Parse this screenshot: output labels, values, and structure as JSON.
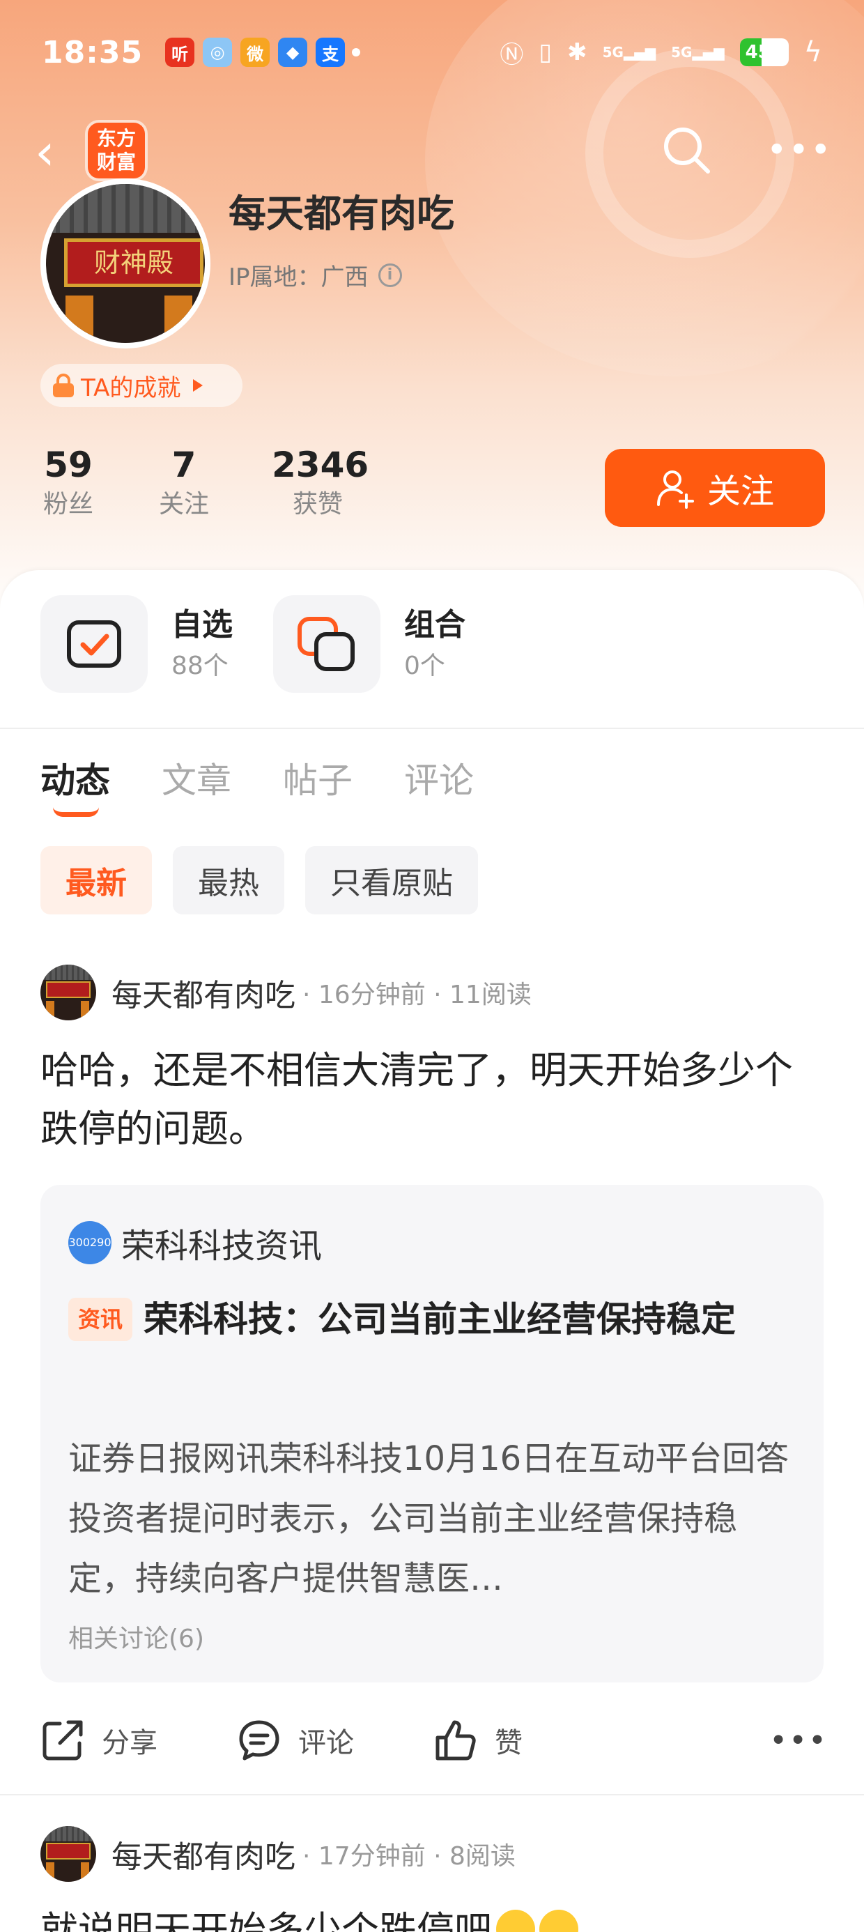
{
  "status_bar": {
    "time": "18:35",
    "app_icons": [
      {
        "name": "ting-app-icon",
        "glyph": "听",
        "color": "#e8321f"
      },
      {
        "name": "photos-app-icon",
        "glyph": "◎",
        "color": "#8dc6f5"
      },
      {
        "name": "weibo-app-icon",
        "glyph": "微",
        "color": "#f7a521"
      },
      {
        "name": "shazam-app-icon",
        "glyph": "◆",
        "color": "#2f86f2"
      },
      {
        "name": "alipay-app-icon",
        "glyph": "支",
        "color": "#1677ff"
      }
    ],
    "signal_1": "5G",
    "signal_2": "5G",
    "battery_level": "45",
    "battery_fraction": 0.45
  },
  "header": {
    "brand_badge": "东方\n财富"
  },
  "profile": {
    "name": "每天都有肉吃",
    "ip_label": "IP属地：广西",
    "achievement": "TA的成就",
    "avatar_plaque": "财神殿",
    "stats": [
      {
        "value": "59",
        "label": "粉丝"
      },
      {
        "value": "7",
        "label": "关注"
      },
      {
        "value": "2346",
        "label": "获赞"
      }
    ],
    "follow_label": "关注"
  },
  "shortcuts": [
    {
      "title": "自选",
      "count": "88个"
    },
    {
      "title": "组合",
      "count": "0个"
    }
  ],
  "tabs": [
    "动态",
    "文章",
    "帖子",
    "评论"
  ],
  "filters": [
    "最新",
    "最热",
    "只看原贴"
  ],
  "posts": [
    {
      "author": "每天都有肉吃",
      "meta": "· 16分钟前 · 11阅读",
      "text": "哈哈，还是不相信大清完了，明天开始多少个跌停的问题。",
      "quote": {
        "source_code": "300290",
        "source_name": "荣科科技资讯",
        "tag": "资讯",
        "title": "荣科科技：公司当前主业经营保持稳定",
        "body": "证券日报网讯荣科科技10月16日在互动平台回答投资者提问时表示，公司当前主业经营保持稳定，持续向客户提供智慧医…",
        "related": "相关讨论(6)"
      },
      "actions": {
        "share": "分享",
        "comment": "评论",
        "like": "赞"
      }
    },
    {
      "author": "每天都有肉吃",
      "meta": "· 17分钟前 · 8阅读",
      "text": "就说明天开始多少个跌停吧"
    }
  ],
  "colors": {
    "accent": "#ff5a10",
    "header_gradient_top": "#f7a67c",
    "battery_green": "#2fc22f"
  }
}
